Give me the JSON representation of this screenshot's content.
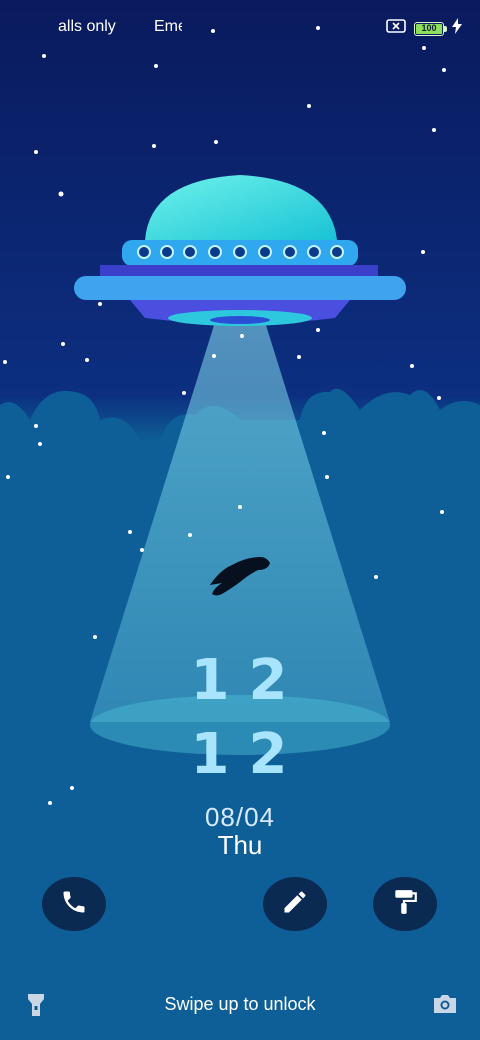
{
  "status_bar": {
    "left_text_1": "alls only",
    "left_text_2": "Eme",
    "battery_level": "100",
    "icons": [
      "sim-card-x-icon",
      "battery-icon",
      "charging-bolt-icon"
    ]
  },
  "clock": {
    "hour_digits": [
      "1",
      "2"
    ],
    "minute_digits": [
      "1",
      "2"
    ]
  },
  "date": {
    "date": "08/04",
    "weekday": "Thu"
  },
  "shortcuts": [
    "phone-icon",
    "pen-icon",
    "paint-roller-icon"
  ],
  "bottom": {
    "swipe_text": "Swipe up to unlock",
    "left_icon": "flashlight-icon",
    "right_icon": "camera-icon"
  },
  "colors": {
    "sky_top": "#0a1f63",
    "ocean": "#0c5b95",
    "ufo_dome": "#37e5e0",
    "ufo_body": "#3f8df0",
    "clock": "#a9e4ff"
  }
}
